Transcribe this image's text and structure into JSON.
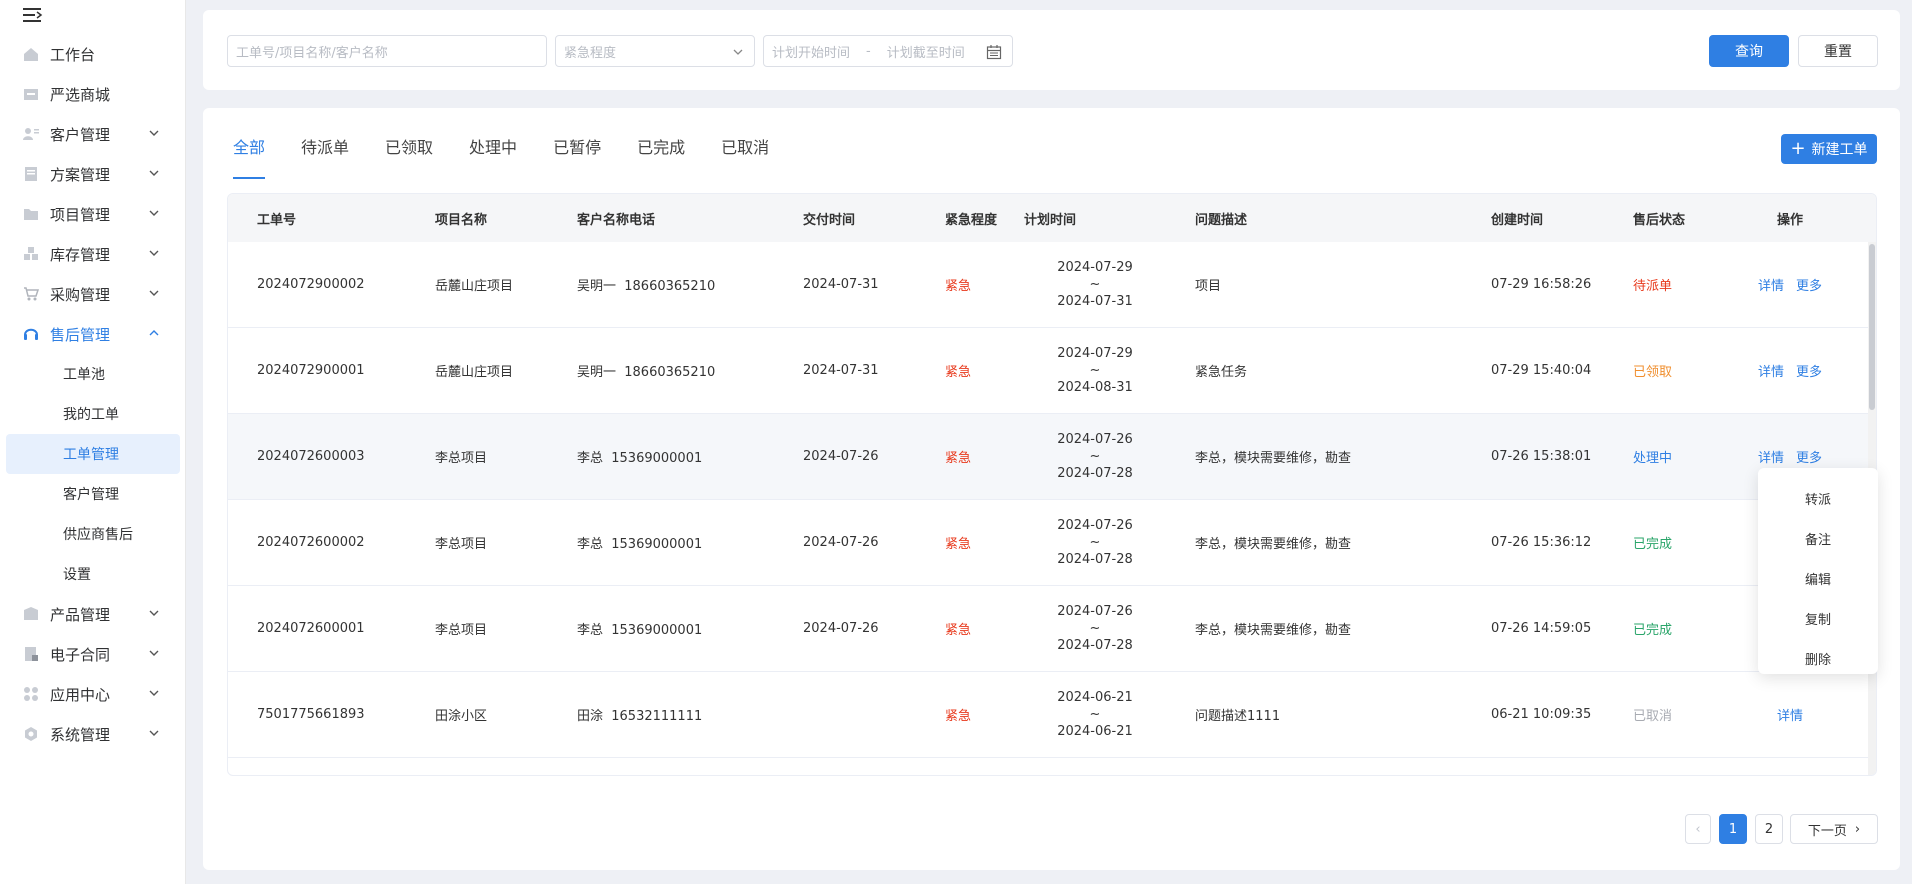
{
  "sidebar": {
    "items": [
      {
        "label": "工作台",
        "icon": "home-icon"
      },
      {
        "label": "严选商城",
        "icon": "store-icon"
      },
      {
        "label": "客户管理",
        "icon": "customer-icon"
      },
      {
        "label": "方案管理",
        "icon": "plan-icon"
      },
      {
        "label": "项目管理",
        "icon": "folder-icon"
      },
      {
        "label": "库存管理",
        "icon": "inventory-icon"
      },
      {
        "label": "采购管理",
        "icon": "cart-icon"
      },
      {
        "label": "售后管理",
        "icon": "headset-icon"
      },
      {
        "label": "产品管理",
        "icon": "product-icon"
      },
      {
        "label": "电子合同",
        "icon": "contract-icon"
      },
      {
        "label": "应用中心",
        "icon": "apps-icon"
      },
      {
        "label": "系统管理",
        "icon": "system-icon"
      }
    ],
    "subitems": [
      "工单池",
      "我的工单",
      "工单管理",
      "客户管理",
      "供应商售后",
      "设置"
    ]
  },
  "search": {
    "keyword_placeholder": "工单号/项目名称/客户名称",
    "urgency_placeholder": "紧急程度",
    "start_placeholder": "计划开始时间",
    "separator": "-",
    "end_placeholder": "计划截至时间",
    "query_label": "查询",
    "reset_label": "重置"
  },
  "tabs": [
    "全部",
    "待派单",
    "已领取",
    "处理中",
    "已暂停",
    "已完成",
    "已取消"
  ],
  "new_button": "新建工单",
  "table": {
    "headers": [
      "工单号",
      "项目名称",
      "客户名称电话",
      "交付时间",
      "紧急程度",
      "计划时间",
      "问题描述",
      "创建时间",
      "售后状态",
      "操作"
    ],
    "rows": [
      {
        "id": "2024072900002",
        "project": "岳麓山庄项目",
        "customer": "吴明一  18660365210",
        "delivery": "2024-07-31",
        "urgency": "紧急",
        "plan_start": "2024-07-29",
        "plan_sep": "~",
        "plan_end": "2024-07-31",
        "desc": "项目",
        "created": "07-29 16:58:26",
        "status": "待派单",
        "detail": "详情",
        "more": "更多"
      },
      {
        "id": "2024072900001",
        "project": "岳麓山庄项目",
        "customer": "吴明一  18660365210",
        "delivery": "2024-07-31",
        "urgency": "紧急",
        "plan_start": "2024-07-29",
        "plan_sep": "~",
        "plan_end": "2024-08-31",
        "desc": "紧急任务",
        "created": "07-29 15:40:04",
        "status": "已领取",
        "detail": "详情",
        "more": "更多"
      },
      {
        "id": "2024072600003",
        "project": "李总项目",
        "customer": "李总  15369000001",
        "delivery": "2024-07-26",
        "urgency": "紧急",
        "plan_start": "2024-07-26",
        "plan_sep": "~",
        "plan_end": "2024-07-28",
        "desc": "李总，模块需要维修，勘查",
        "created": "07-26 15:38:01",
        "status": "处理中",
        "detail": "详情",
        "more": "更多"
      },
      {
        "id": "2024072600002",
        "project": "李总项目",
        "customer": "李总  15369000001",
        "delivery": "2024-07-26",
        "urgency": "紧急",
        "plan_start": "2024-07-26",
        "plan_sep": "~",
        "plan_end": "2024-07-28",
        "desc": "李总，模块需要维修，勘查",
        "created": "07-26 15:36:12",
        "status": "已完成"
      },
      {
        "id": "2024072600001",
        "project": "李总项目",
        "customer": "李总  15369000001",
        "delivery": "2024-07-26",
        "urgency": "紧急",
        "plan_start": "2024-07-26",
        "plan_sep": "~",
        "plan_end": "2024-07-28",
        "desc": "李总，模块需要维修，勘查",
        "created": "07-26 14:59:05",
        "status": "已完成"
      },
      {
        "id": "7501775661893",
        "project": "田涂小区",
        "customer": "田涂  16532111111",
        "delivery": "",
        "urgency": "紧急",
        "plan_start": "2024-06-21",
        "plan_sep": "~",
        "plan_end": "2024-06-21",
        "desc": "问题描述1111",
        "created": "06-21 10:09:35",
        "status": "已取消",
        "detail": "详情"
      }
    ]
  },
  "dropdown": [
    "转派",
    "备注",
    "编辑",
    "复制",
    "删除"
  ],
  "pagination": {
    "pages": [
      "1",
      "2"
    ],
    "next": "下一页"
  },
  "colors": {
    "primary": "#2f7fe3",
    "urgent": "#e8391c",
    "done": "#2aa56a",
    "claimed": "#f08f2f",
    "cancelled": "#a8abb2"
  }
}
